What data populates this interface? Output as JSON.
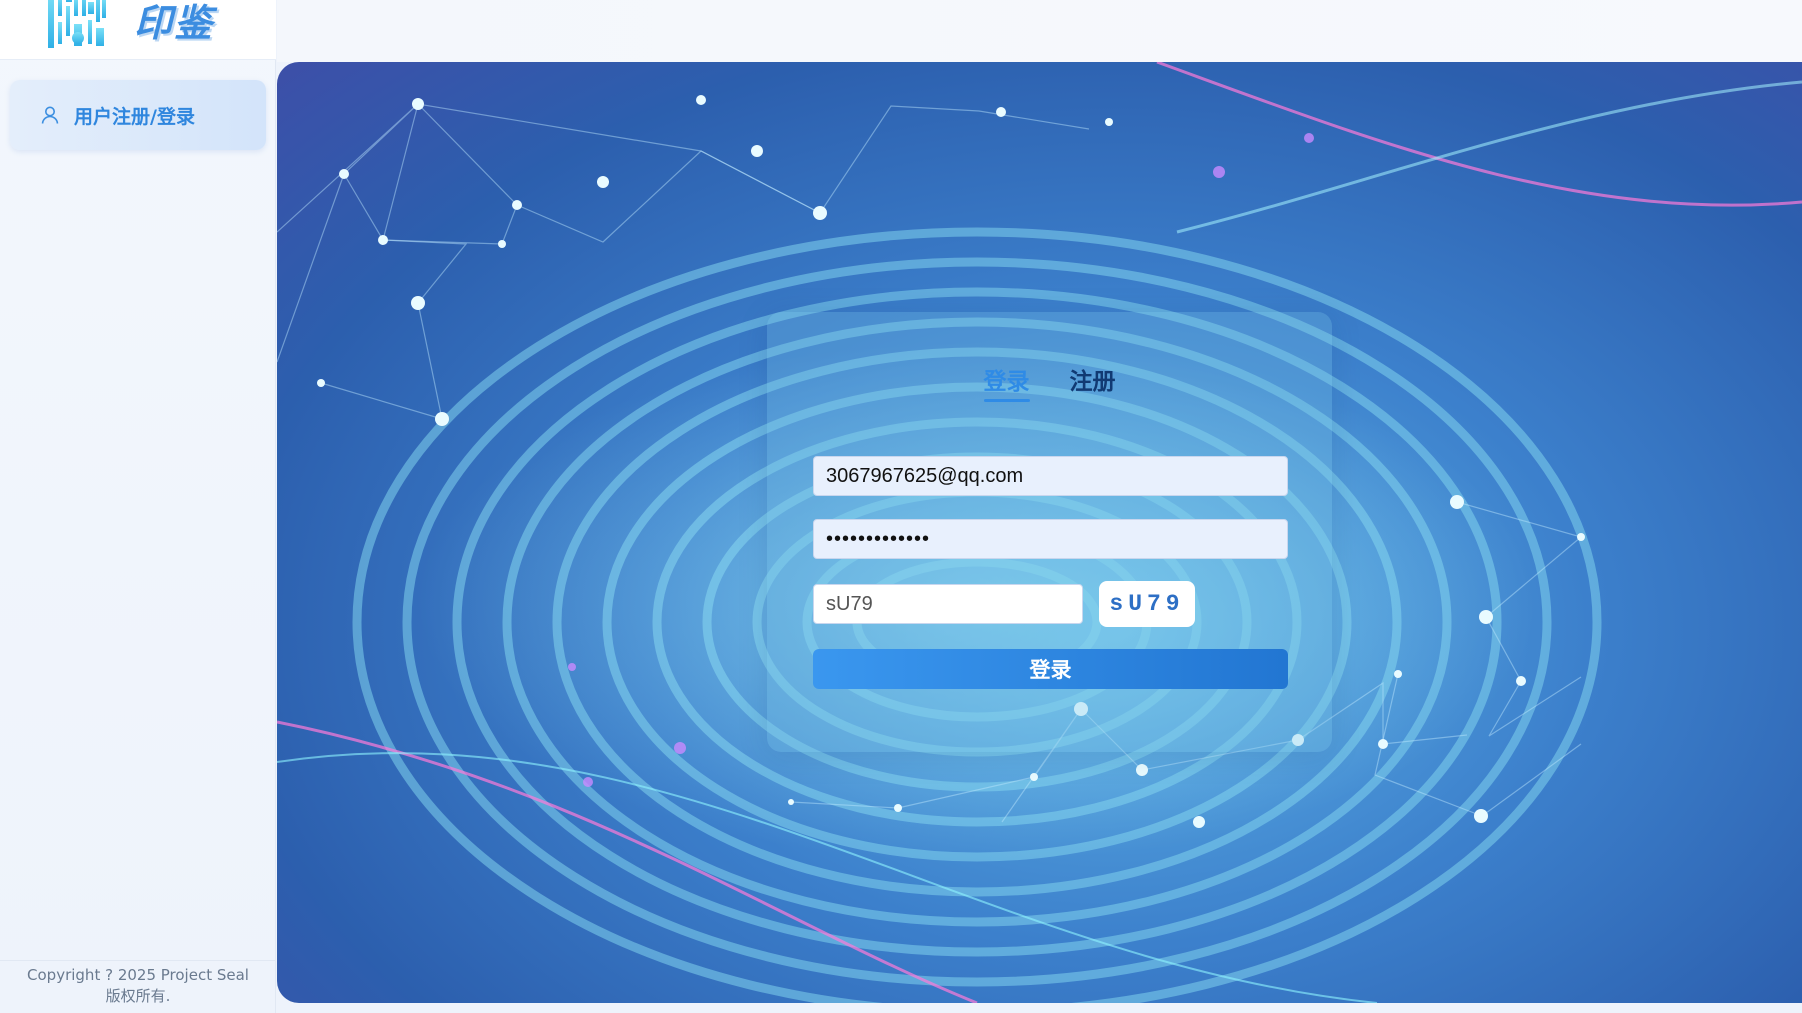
{
  "brand": {
    "logo_text": "印鉴",
    "logo_icon": "qr-seal-icon"
  },
  "sidebar": {
    "items": [
      {
        "label": "用户注册/登录",
        "icon": "user-icon"
      }
    ]
  },
  "footer": {
    "copyright": "Copyright ? 2025 Project Seal",
    "rights": "版权所有."
  },
  "login_form": {
    "tabs": [
      {
        "label": "登录",
        "active": true
      },
      {
        "label": "注册",
        "active": false
      }
    ],
    "email_value": "3067967625@qq.com",
    "password_value": "•••••••••••••",
    "captcha_input_value": "sU79",
    "captcha_code": "sU79",
    "submit_label": "登录"
  },
  "colors": {
    "accent": "#2f8be6",
    "sidebar_active_text": "#2f86de",
    "button_start": "#3a97ef",
    "button_end": "#2276d2",
    "tab_inactive": "#113a73"
  }
}
